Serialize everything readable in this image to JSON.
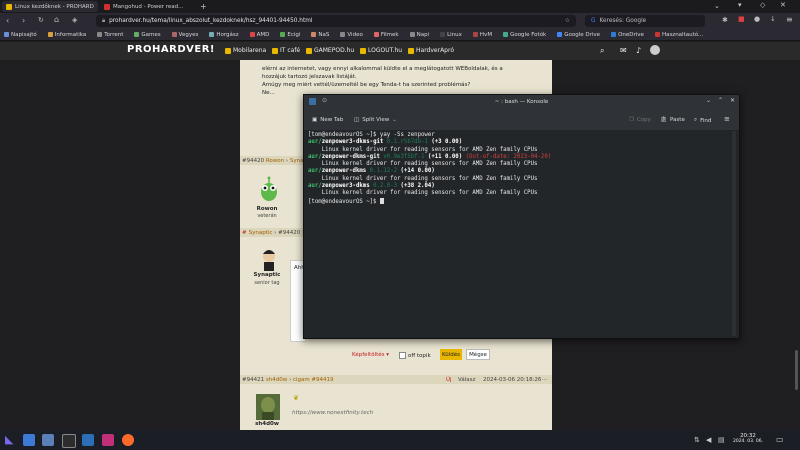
{
  "browser": {
    "tabs": [
      {
        "label": "Linux kezdőknek - PROHARD",
        "color": "#e8b700"
      },
      {
        "label": "Mangohud - Power read...",
        "color": "#d03030"
      }
    ],
    "url": "prohardver.hu/tema/linux_abszolut_kezdoknek/hsz_94401-94450.html",
    "search_placeholder": "Keresés: Google",
    "bookmarks": [
      "Napisajtó",
      "Informatika",
      "Torrent",
      "Games",
      "Vegyes",
      "Horgász",
      "AMD",
      "Ecigi",
      "NaS",
      "Video",
      "Filmek",
      "Napi",
      "Linux",
      "HvM",
      "Google Fotók",
      "Google Drive",
      "OneDrive",
      "Hasznaltautó..."
    ]
  },
  "site": {
    "logo": "PROHARDVER!",
    "nav": [
      "Mobilarena",
      "IT café",
      "GAMEPOD.hu",
      "LOGOUT.hu",
      "HardverApró"
    ]
  },
  "post_top": {
    "lines": [
      "hozzájuk tartozó jelszavak listáját.",
      "Amúgy meg miért vettél/üzemeltél be egy Tenda-t ha szerinted problémás?",
      "Ne..."
    ],
    "line0": "elérni az internetet, vagy ennyi alkalommal küldte el a meglátogatott WEBoldalak, és a"
  },
  "posts": [
    {
      "num": "#94420",
      "user": "Rowon",
      "rank": "veterán",
      "reply_to": "Synaptic"
    },
    {
      "num": "#94420",
      "user": "Synaptic",
      "rank": "senior tag"
    },
    {
      "num": "#94421",
      "user": "sh4d0w",
      "reply_to": "cigam #94419",
      "meta_new": "Új",
      "meta_reply": "Válasz",
      "date": "2024-03-06 20:18:26",
      "link": "https://www.nonextfinity.tech"
    }
  ],
  "reply_box": {
    "formatting": "Képfeltöltés",
    "offtopic": "off topik",
    "send": "Küldés",
    "cancel": "Mégse",
    "preview_prefix": "Ahh"
  },
  "terminal": {
    "title": "~ : bash — Konsole",
    "toolbar": {
      "new_tab": "New Tab",
      "split": "Split View",
      "copy": "Copy",
      "paste": "Paste",
      "find": "Find"
    },
    "prompt": "[tom@endeavourOS ~]$",
    "command": "yay -Ss zenpower",
    "results": [
      {
        "repo": "aur/",
        "name": "zenpower3-dkms-git",
        "ver": "0.1.r5b7db-1",
        "votes": "(+3 0.00)",
        "flag": "",
        "desc": "Linux kernel driver for reading sensors for AMD Zen family CPUs"
      },
      {
        "repo": "aur/",
        "name": "zenpower-dkms-git",
        "ver": "v0.9e3f5bf-1",
        "votes": "(+11 0.00)",
        "flag": "(Out-of-date: 2023-04-20)",
        "desc": "Linux kernel driver for reading sensors for AMD Zen family CPUs"
      },
      {
        "repo": "aur/",
        "name": "zenpower-dkms",
        "ver": "0.1.12-2",
        "votes": "(+14 0.00)",
        "flag": "",
        "desc": "Linux kernel driver for reading sensors for AMD Zen family CPUs"
      },
      {
        "repo": "aur/",
        "name": "zenpower3-dkms",
        "ver": "0.2.0-3",
        "votes": "(+38 2.04)",
        "flag": "",
        "desc": "Linux kernel driver for reading sensors for AMD Zen family CPUs"
      }
    ]
  },
  "taskbar": {
    "time": "20:32",
    "date": "2024. 03. 06."
  },
  "colors": {
    "accent": "#e8b700",
    "aur_green": "#3fbf6f",
    "flag_red": "#d04040"
  }
}
